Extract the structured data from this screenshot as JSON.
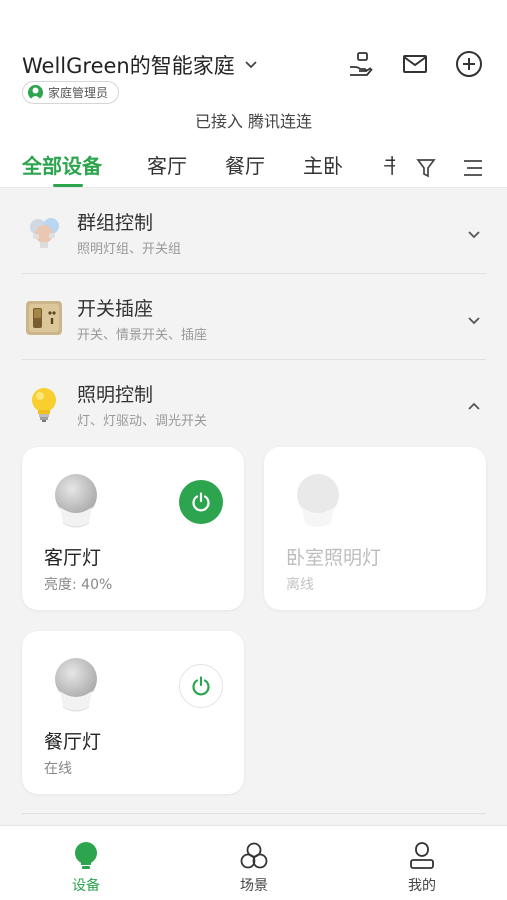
{
  "header": {
    "home_name": "WellGreen的智能家庭",
    "role_badge": "家庭管理员",
    "connection_status": "已接入 腾讯连连",
    "icons": [
      "hand-device-icon",
      "mail-icon",
      "add-circle-icon"
    ]
  },
  "tabs": {
    "items": [
      "全部设备",
      "客厅",
      "餐厅",
      "主卧"
    ],
    "active": "全部设备",
    "overflow_partial": "书"
  },
  "groups": [
    {
      "title": "群组控制",
      "subtitle": "照明灯组、开关组",
      "icon": "group-bulbs-icon",
      "expanded": false
    },
    {
      "title": "开关插座",
      "subtitle": "开关、情景开关、插座",
      "icon": "switch-socket-icon",
      "expanded": false
    },
    {
      "title": "照明控制",
      "subtitle": "灯、灯驱动、调光开关",
      "icon": "light-bulb-icon",
      "expanded": true
    }
  ],
  "devices": [
    {
      "name": "客厅灯",
      "status": "亮度: 40%",
      "power": "on",
      "online": true
    },
    {
      "name": "卧室照明灯",
      "status": "离线",
      "power": "none",
      "online": false
    },
    {
      "name": "餐厅灯",
      "status": "在线",
      "power": "off",
      "online": true
    }
  ],
  "bottom_nav": {
    "items": [
      "设备",
      "场景",
      "我的"
    ],
    "active": "设备"
  },
  "colors": {
    "accent": "#2da44e",
    "background": "#f3f3f3",
    "card": "#ffffff"
  }
}
